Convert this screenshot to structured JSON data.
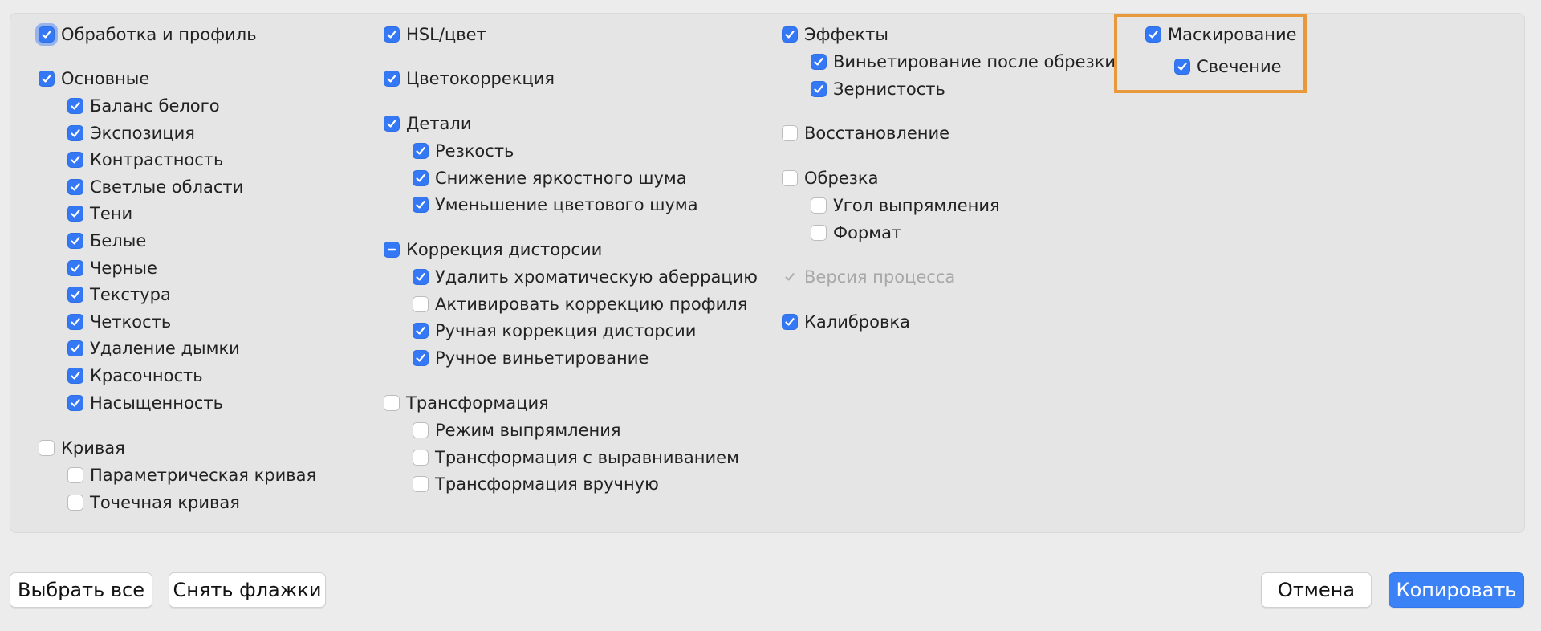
{
  "accent_color": "#3478f6",
  "highlight_color": "#e8993c",
  "columns": {
    "col1": {
      "processing": {
        "label": "Обработка и профиль",
        "state": "checked"
      },
      "basic": {
        "label": "Основные",
        "state": "checked"
      },
      "basic_items": [
        {
          "label": "Баланс белого",
          "state": "checked"
        },
        {
          "label": "Экспозиция",
          "state": "checked"
        },
        {
          "label": "Контрастность",
          "state": "checked"
        },
        {
          "label": "Светлые области",
          "state": "checked"
        },
        {
          "label": "Тени",
          "state": "checked"
        },
        {
          "label": "Белые",
          "state": "checked"
        },
        {
          "label": "Черные",
          "state": "checked"
        },
        {
          "label": "Текстура",
          "state": "checked"
        },
        {
          "label": "Четкость",
          "state": "checked"
        },
        {
          "label": "Удаление дымки",
          "state": "checked"
        },
        {
          "label": "Красочность",
          "state": "checked"
        },
        {
          "label": "Насыщенность",
          "state": "checked"
        }
      ],
      "curve": {
        "label": "Кривая",
        "state": "unchecked"
      },
      "curve_items": [
        {
          "label": "Параметрическая кривая",
          "state": "unchecked"
        },
        {
          "label": "Точечная кривая",
          "state": "unchecked"
        }
      ]
    },
    "col2": {
      "hsl": {
        "label": "HSL/цвет",
        "state": "checked"
      },
      "color_correction": {
        "label": "Цветокоррекция",
        "state": "checked"
      },
      "details": {
        "label": "Детали",
        "state": "checked"
      },
      "details_items": [
        {
          "label": "Резкость",
          "state": "checked"
        },
        {
          "label": "Снижение яркостного шума",
          "state": "checked"
        },
        {
          "label": "Уменьшение цветового шума",
          "state": "checked"
        }
      ],
      "lens": {
        "label": "Коррекция дисторсии",
        "state": "mixed"
      },
      "lens_items": [
        {
          "label": "Удалить хроматическую аберрацию",
          "state": "checked"
        },
        {
          "label": "Активировать коррекцию профиля",
          "state": "unchecked"
        },
        {
          "label": "Ручная коррекция дисторсии",
          "state": "checked"
        },
        {
          "label": "Ручное виньетирование",
          "state": "checked"
        }
      ],
      "transform": {
        "label": "Трансформация",
        "state": "unchecked"
      },
      "transform_items": [
        {
          "label": "Режим выпрямления",
          "state": "unchecked"
        },
        {
          "label": "Трансформация с выравниванием",
          "state": "unchecked"
        },
        {
          "label": "Трансформация вручную",
          "state": "unchecked"
        }
      ]
    },
    "col3": {
      "effects": {
        "label": "Эффекты",
        "state": "checked"
      },
      "effects_items": [
        {
          "label": "Виньетирование после обрезки",
          "state": "checked"
        },
        {
          "label": "Зернистость",
          "state": "checked"
        }
      ],
      "restore": {
        "label": "Восстановление",
        "state": "unchecked"
      },
      "crop": {
        "label": "Обрезка",
        "state": "unchecked"
      },
      "crop_items": [
        {
          "label": "Угол выпрямления",
          "state": "unchecked"
        },
        {
          "label": "Формат",
          "state": "unchecked"
        }
      ],
      "process_version": {
        "label": "Версия процесса",
        "state": "disabled-checked"
      },
      "calibration": {
        "label": "Калибровка",
        "state": "checked"
      }
    },
    "col4": {
      "masking": {
        "label": "Маскирование",
        "state": "checked"
      },
      "masking_items": [
        {
          "label": "Свечение",
          "state": "checked"
        }
      ]
    }
  },
  "buttons": {
    "select_all": "Выбрать все",
    "uncheck": "Снять флажки",
    "cancel": "Отмена",
    "copy": "Копировать"
  }
}
